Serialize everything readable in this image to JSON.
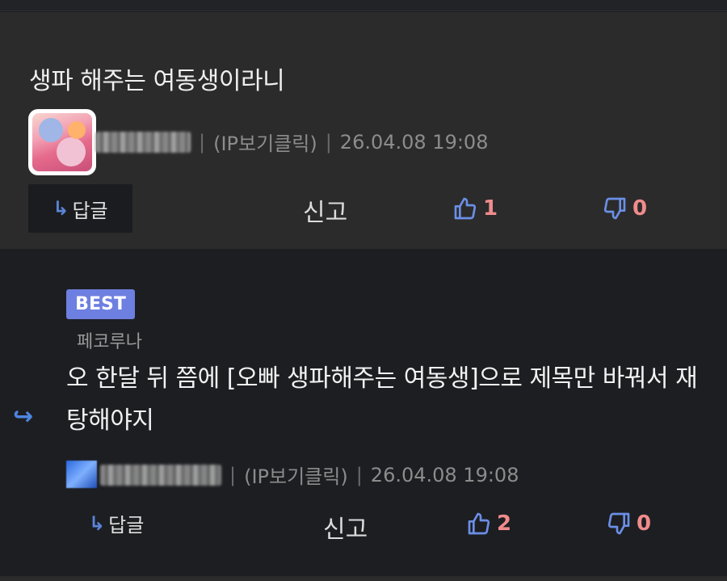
{
  "comment": {
    "text": "생파 해주는 여동생이라니",
    "author_blurred": "",
    "ip_label": "(IP보기클릭)",
    "timestamp": "26.04.08 19:08",
    "reply_label": "답글",
    "reply_arrow": "↳",
    "report_label": "신고",
    "likes": "1",
    "dislikes": "0"
  },
  "reply": {
    "badge": "BEST",
    "reply_to": "페코루나",
    "indicator": "↪",
    "text": "오 한달 뒤 쯤에 [오빠 생파해주는 여동생]으로 제목만 바꿔서 재탕해야지",
    "ip_label": "(IP보기클릭)",
    "timestamp": "26.04.08 19:08",
    "reply_label": "답글",
    "reply_arrow": "↳",
    "report_label": "신고",
    "likes": "2",
    "dislikes": "0"
  },
  "colors": {
    "accent_blue": "#6d7fe0",
    "count_red": "#f08c8c",
    "thumb_blue": "#6b8fe6"
  },
  "icons": [
    "thumbs-up-icon",
    "thumbs-down-icon",
    "reply-arrow-icon"
  ]
}
